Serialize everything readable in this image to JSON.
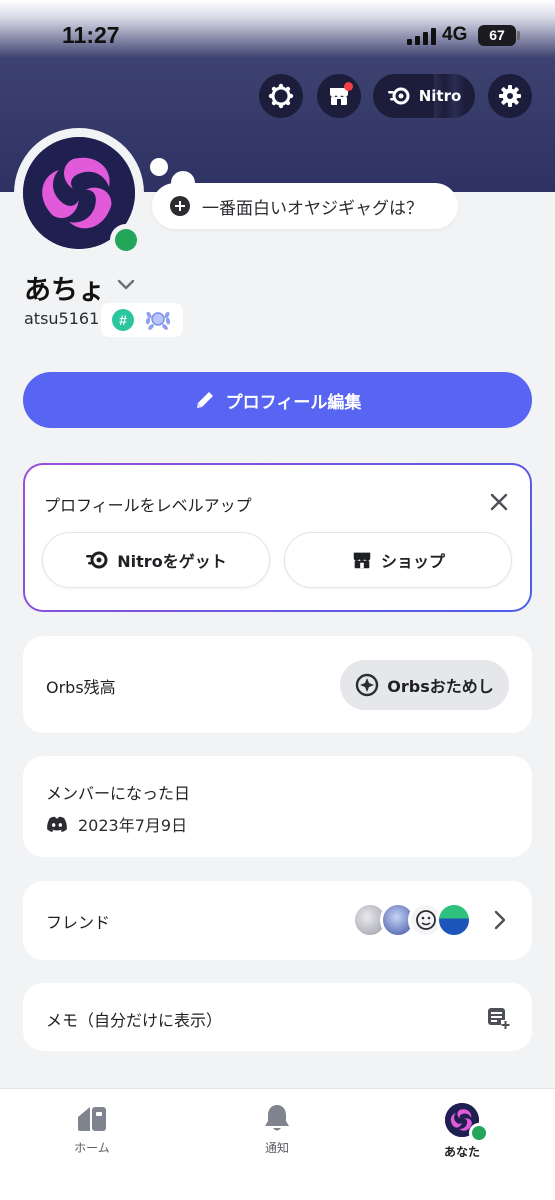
{
  "status_bar": {
    "time": "11:27",
    "network": "4G",
    "battery": "67",
    "battery_level": 0.67
  },
  "header": {
    "nitro_label": "Nitro"
  },
  "profile": {
    "status_bubble": "一番面白いオヤジギャグは？",
    "display_name": "あちょ",
    "username": "atsu5161",
    "badge_hash": "#",
    "edit_label": "プロフィール編集"
  },
  "levelup": {
    "title": "プロフィールをレベルアップ",
    "nitro_label": "Nitroをゲット",
    "shop_label": "ショップ"
  },
  "orbs": {
    "label": "Orbs残高",
    "button": "Orbsおためし"
  },
  "member": {
    "label": "メンバーになった日",
    "date": "2023年7月9日"
  },
  "friends": {
    "label": "フレンド"
  },
  "memo": {
    "label": "メモ（自分だけに表示）"
  },
  "tabs": [
    {
      "label": "ホーム",
      "icon": "home-icon"
    },
    {
      "label": "通知",
      "icon": "bell-icon"
    },
    {
      "label": "あなた",
      "icon": "avatar"
    }
  ],
  "colors": {
    "brand": "#5865f2",
    "online": "#23a55a",
    "banner": "#2e3263",
    "notify": "#f23f43"
  }
}
